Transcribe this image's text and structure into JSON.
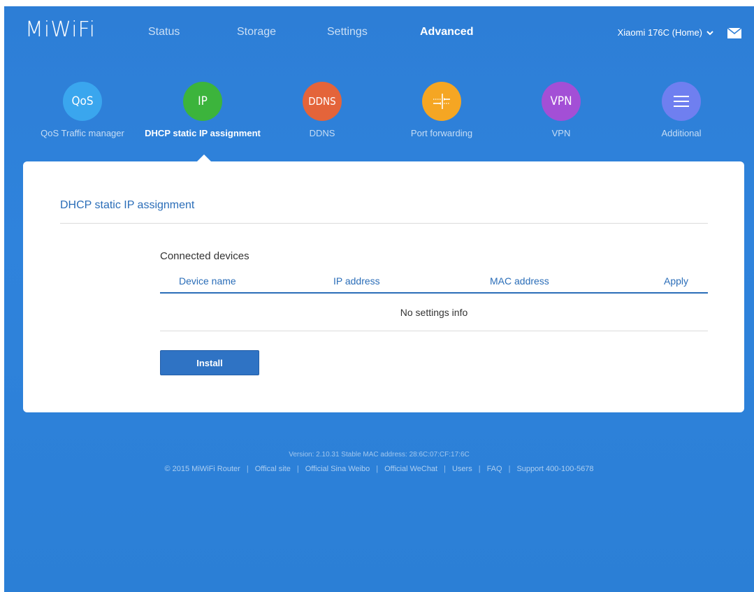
{
  "header": {
    "logo": "MiWiFi",
    "nav": [
      {
        "label": "Status",
        "active": false
      },
      {
        "label": "Storage",
        "active": false
      },
      {
        "label": "Settings",
        "active": false
      },
      {
        "label": "Advanced",
        "active": true
      }
    ],
    "router_name": "Xiaomi 176C (Home)"
  },
  "features": [
    {
      "icon_text": "QoS",
      "label": "QoS Traffic manager",
      "color": "#3aa6ee",
      "active": false
    },
    {
      "icon_text": "IP",
      "label": "DHCP static IP assignment",
      "color": "#3cb43c",
      "active": true
    },
    {
      "icon_text": "DDNS",
      "label": "DDNS",
      "color": "#e4643a",
      "active": false
    },
    {
      "icon": "port-forwarding-icon",
      "label": "Port forwarding",
      "color": "#f5a623",
      "active": false
    },
    {
      "icon_text": "VPN",
      "label": "VPN",
      "color": "#a34fd6",
      "active": false
    },
    {
      "icon": "menu-icon",
      "label": "Additional",
      "color": "#6f7ff0",
      "active": false
    }
  ],
  "card": {
    "title": "DHCP static IP assignment",
    "section_title": "Connected devices",
    "columns": [
      "Device name",
      "IP address",
      "MAC address",
      "Apply"
    ],
    "empty_text": "No settings info",
    "install_label": "Install"
  },
  "footer": {
    "version": "Version: 2.10.31 Stable  MAC address: 28:6C:07:CF:17:6C",
    "links": [
      "© 2015 MiWiFi Router",
      "Offical site",
      "Official Sina Weibo",
      "Official WeChat",
      "Users",
      "FAQ",
      "Support 400-100-5678"
    ]
  }
}
